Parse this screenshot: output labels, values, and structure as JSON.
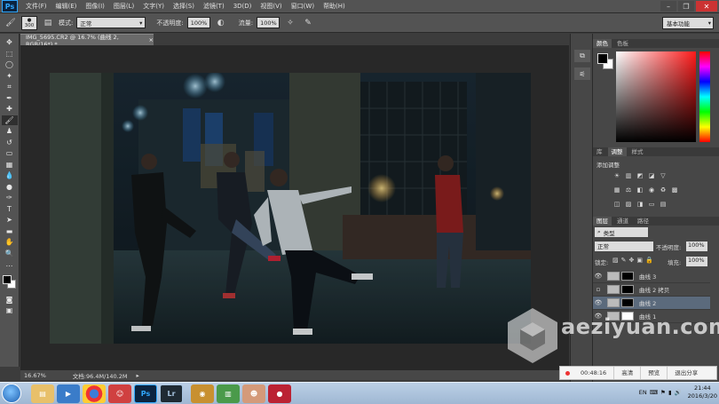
{
  "app": {
    "logo": "Ps"
  },
  "menu": [
    "文件(F)",
    "编辑(E)",
    "图像(I)",
    "图层(L)",
    "文字(Y)",
    "选择(S)",
    "滤镜(T)",
    "3D(D)",
    "视图(V)",
    "窗口(W)",
    "帮助(H)"
  ],
  "options": {
    "brush_size": "300",
    "mode_label": "模式:",
    "mode_value": "正常",
    "opacity_label": "不透明度:",
    "opacity_value": "100%",
    "flow_label": "流量:",
    "flow_value": "100%",
    "workspace": "基本功能"
  },
  "document": {
    "tab_title": "IMG_5695.CR2 @ 16.7% (曲线 2, RGB/16*) *",
    "zoom": "16.67%",
    "doc_info": "文档:96.4M/140.2M"
  },
  "color_panel": {
    "tabs": [
      "颜色",
      "色板"
    ]
  },
  "adjust_panel": {
    "tabs": [
      "库",
      "调整",
      "样式"
    ],
    "title": "添加调整"
  },
  "layers_panel": {
    "tabs": [
      "图层",
      "通道",
      "路径"
    ],
    "filter_label": "类型",
    "blend_mode": "正常",
    "opacity_label": "不透明度:",
    "opacity_value": "100%",
    "lock_label": "锁定:",
    "fill_label": "填充:",
    "fill_value": "100%",
    "layers": [
      {
        "name": "曲线 3",
        "visible": true,
        "selected": false
      },
      {
        "name": "曲线 2 拷贝",
        "visible": false,
        "selected": false
      },
      {
        "name": "曲线 2",
        "visible": true,
        "selected": true
      },
      {
        "name": "曲线 1",
        "visible": true,
        "selected": false
      }
    ]
  },
  "recording": {
    "time": "00:48:16",
    "hd": "高清",
    "preview": "预览",
    "exit": "退出分享"
  },
  "watermark": "aeziyuan.com",
  "taskbar": {
    "apps": [
      "explorer",
      "media",
      "chrome",
      "game",
      "Ps",
      "Lr",
      "app7",
      "app8",
      "app9",
      "app10"
    ],
    "tray_lang": "EN",
    "time": "21:44",
    "date": "2016/3/20"
  }
}
